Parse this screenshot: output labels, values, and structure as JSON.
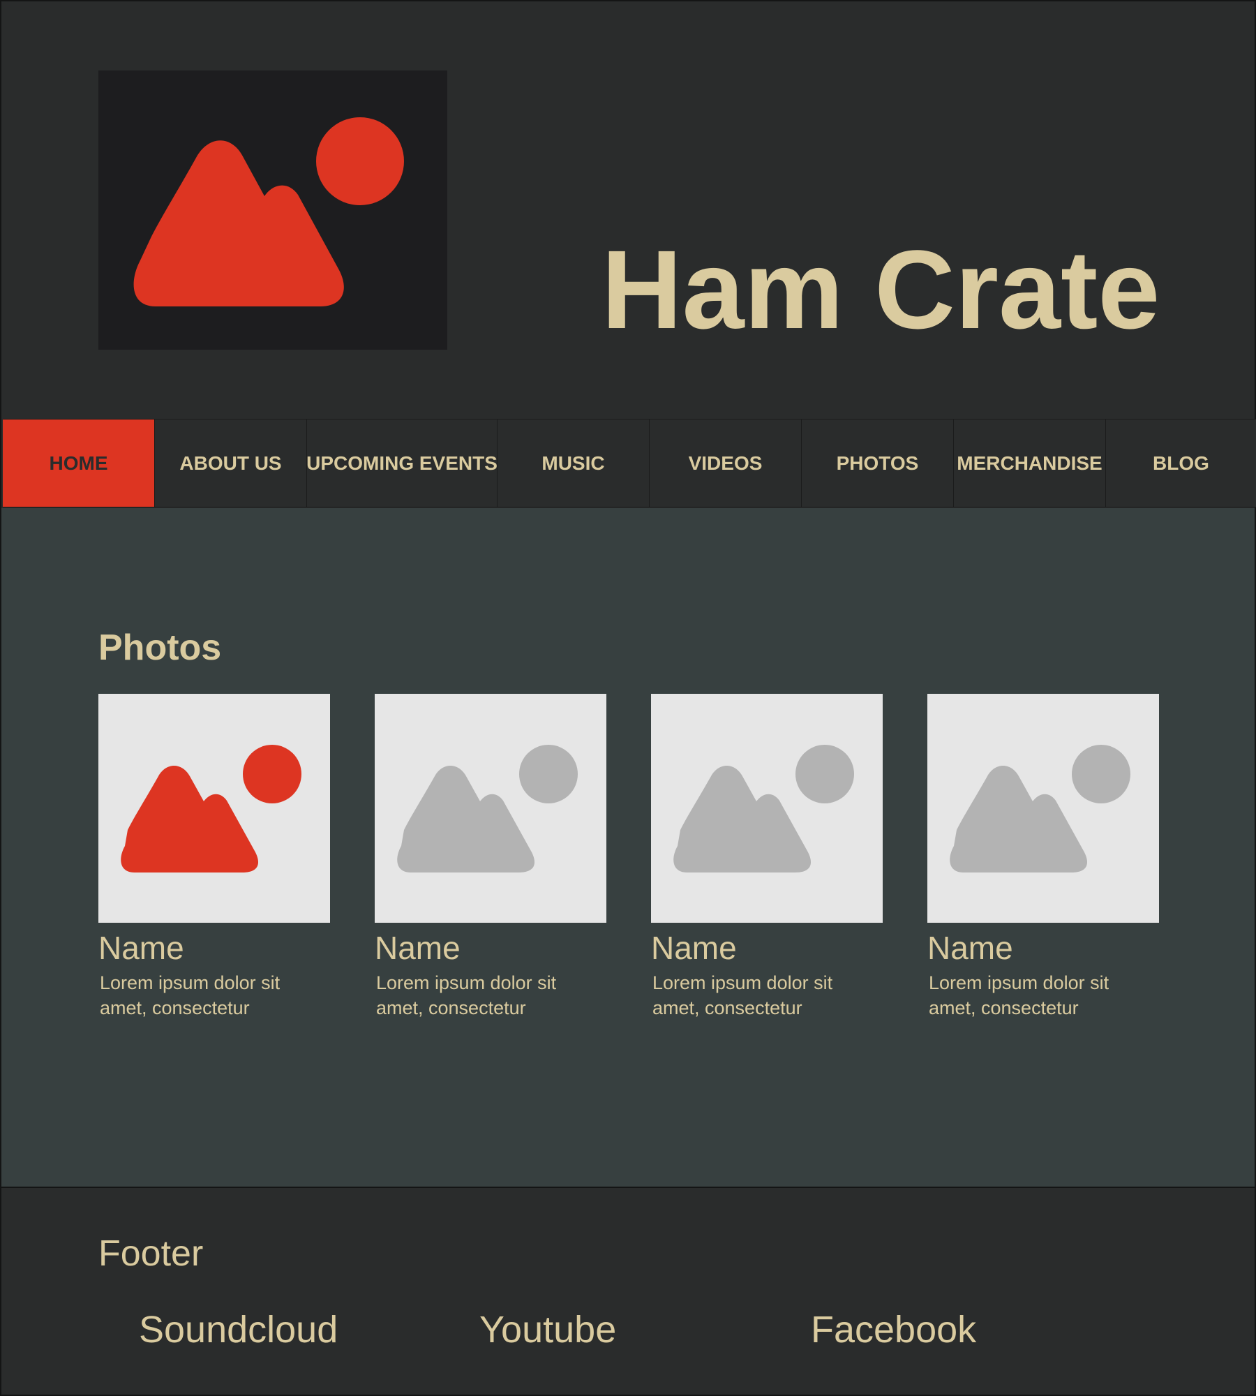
{
  "colors": {
    "background": "#2a2c2c",
    "main_background": "#374040",
    "accent": "#dd3522",
    "text": "#dacb9f",
    "logo_background": "#1d1d1f",
    "placeholder_background": "#e6e6e6",
    "placeholder_icon": "#b3b3b3"
  },
  "header": {
    "logo_icon": "image-placeholder-icon",
    "site_title": "Ham Crate"
  },
  "nav": {
    "items": [
      {
        "label": "HOME",
        "active": true
      },
      {
        "label": "ABOUT US",
        "active": false
      },
      {
        "label": "UPCOMING EVENTS",
        "active": false
      },
      {
        "label": "MUSIC",
        "active": false
      },
      {
        "label": "VIDEOS",
        "active": false
      },
      {
        "label": "PHOTOS",
        "active": false
      },
      {
        "label": "MERCHANDISE",
        "active": false
      },
      {
        "label": "BLOG",
        "active": false
      }
    ]
  },
  "main": {
    "heading": "Photos",
    "cards": [
      {
        "name": "Name",
        "description": "Lorem ipsum dolor sit amet, consectetur",
        "icon": "image-placeholder-icon",
        "highlighted": true
      },
      {
        "name": "Name",
        "description": "Lorem ipsum dolor sit amet, consectetur",
        "icon": "image-placeholder-icon",
        "highlighted": false
      },
      {
        "name": "Name",
        "description": "Lorem ipsum dolor sit amet, consectetur",
        "icon": "image-placeholder-icon",
        "highlighted": false
      },
      {
        "name": "Name",
        "description": "Lorem ipsum dolor sit amet, consectetur",
        "icon": "image-placeholder-icon",
        "highlighted": false
      }
    ]
  },
  "footer": {
    "title": "Footer",
    "links": [
      {
        "label": "Soundcloud"
      },
      {
        "label": "Youtube"
      },
      {
        "label": "Facebook"
      }
    ]
  }
}
